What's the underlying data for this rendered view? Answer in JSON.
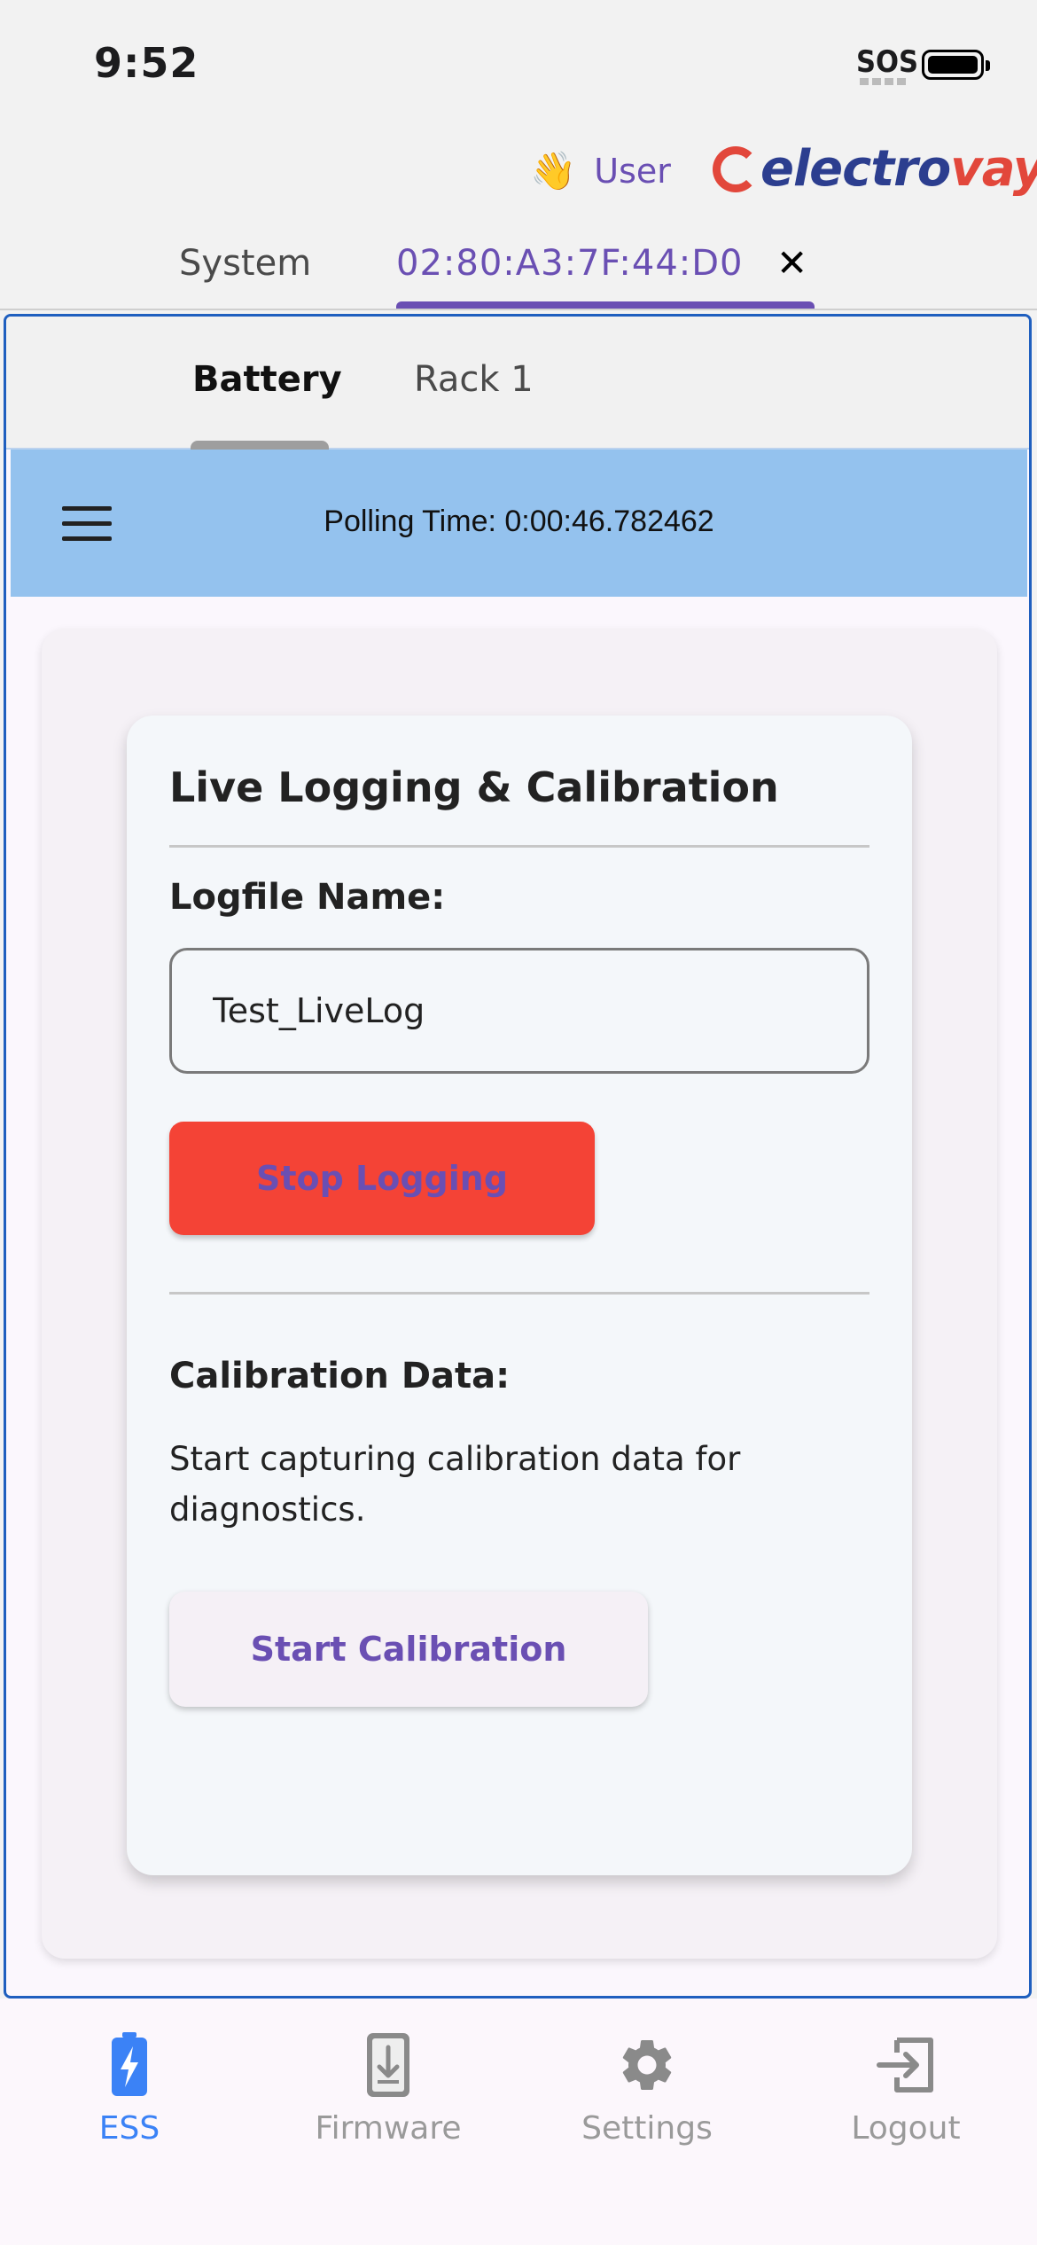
{
  "status_bar": {
    "time": "9:52",
    "sos": "SOS"
  },
  "header": {
    "greeting_emoji": "👋",
    "user_label": "User",
    "logo_text_a": "electro",
    "logo_text_b": "vaya"
  },
  "top_tabs": {
    "system": "System",
    "device": "02:80:A3:7F:44:D0",
    "close": "✕"
  },
  "sub_tabs": {
    "battery": "Battery",
    "rack": "Rack 1"
  },
  "polling": {
    "text": "Polling Time: 0:00:46.782462"
  },
  "card": {
    "title": "Live Logging & Calibration",
    "logfile_label": "Logfile Name:",
    "logfile_value": "Test_LiveLog",
    "stop_button": "Stop Logging",
    "calibration_label": "Calibration Data:",
    "calibration_desc": "Start capturing calibration data for diagnostics.",
    "calibration_button": "Start Calibration"
  },
  "bottom_nav": {
    "items": [
      {
        "label": "ESS",
        "icon": "battery-bolt-icon",
        "active": true
      },
      {
        "label": "Firmware",
        "icon": "firmware-download-icon",
        "active": false
      },
      {
        "label": "Settings",
        "icon": "gear-icon",
        "active": false
      },
      {
        "label": "Logout",
        "icon": "logout-icon",
        "active": false
      }
    ]
  },
  "colors": {
    "accent": "#6a4fb3",
    "stop": "#f44336",
    "poll_bar": "#94c2ee",
    "nav_active": "#3b82f6",
    "frame_border": "#1f5fbf"
  }
}
